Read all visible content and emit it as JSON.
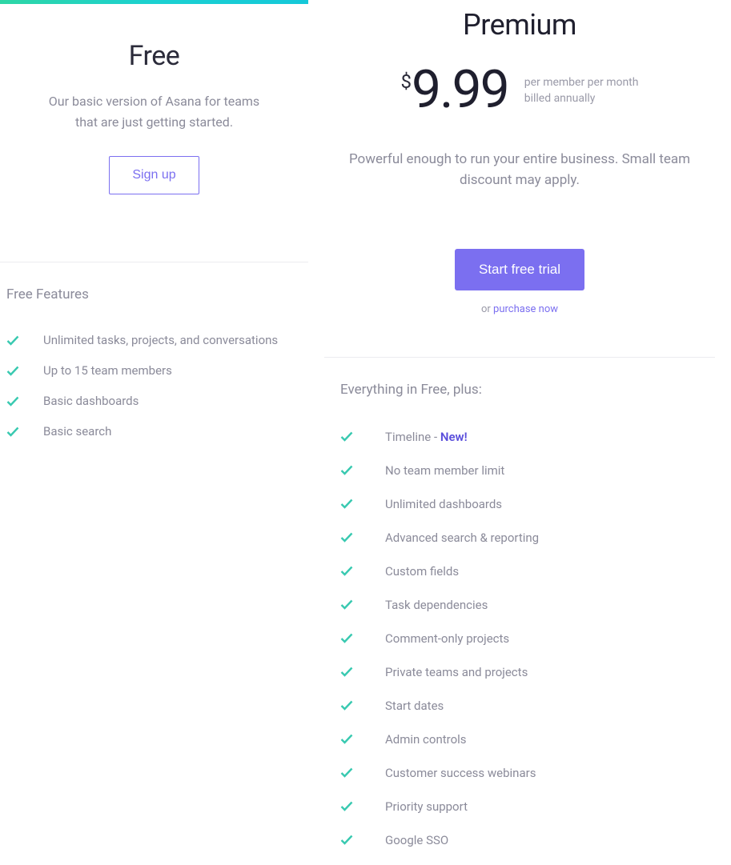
{
  "plans": {
    "free": {
      "title": "Free",
      "description": "Our basic version of Asana for teams that are just getting started.",
      "cta_label": "Sign up",
      "features_heading": "Free Features",
      "features": [
        "Unlimited tasks, projects, and conversations",
        "Up to 15 team members",
        "Basic dashboards",
        "Basic search"
      ]
    },
    "premium": {
      "title": "Premium",
      "currency": "$",
      "price": "9.99",
      "price_note_1": "per member per month",
      "price_note_2": "billed annually",
      "description": "Powerful enough to run your entire business. Small team discount may apply.",
      "cta_label": "Start free trial",
      "or_prefix": "or ",
      "purchase_link": "purchase now",
      "features_heading": "Everything in Free, plus:",
      "features": [
        {
          "text": "Timeline - ",
          "badge": "New!"
        },
        {
          "text": "No team member limit"
        },
        {
          "text": "Unlimited dashboards"
        },
        {
          "text": "Advanced search & reporting"
        },
        {
          "text": "Custom fields"
        },
        {
          "text": "Task dependencies"
        },
        {
          "text": "Comment-only projects"
        },
        {
          "text": "Private teams and projects"
        },
        {
          "text": "Start dates"
        },
        {
          "text": "Admin controls"
        },
        {
          "text": "Customer success webinars"
        },
        {
          "text": "Priority support"
        },
        {
          "text": "Google SSO"
        }
      ]
    }
  },
  "colors": {
    "accent": "#7b6ff0",
    "check": "#38c9b0"
  }
}
